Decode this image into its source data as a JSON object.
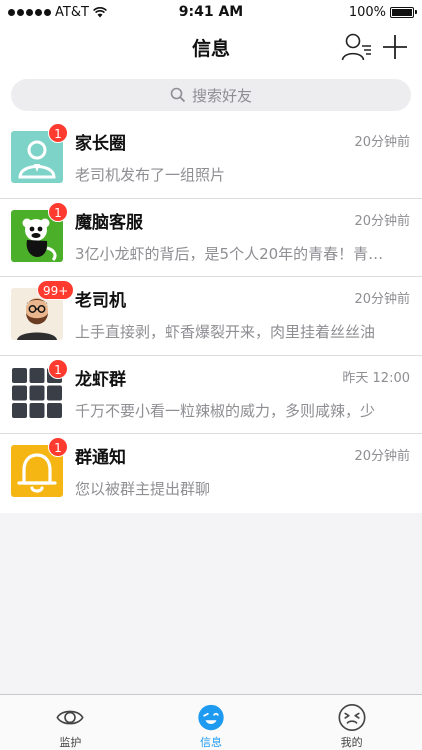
{
  "status_bar": {
    "carrier": "AT&T",
    "time": "9:41 AM",
    "battery": "100%"
  },
  "header": {
    "title": "信息"
  },
  "search": {
    "placeholder": "搜索好友"
  },
  "chats": [
    {
      "name": "家长圈",
      "time": "20分钟前",
      "preview": "老司机发布了一组照片",
      "badge": "1",
      "avatar": "parents-circle-avatar"
    },
    {
      "name": "魔脑客服",
      "time": "20分钟前",
      "preview": "3亿小龙虾的背后，是5个人20年的青春！青…",
      "badge": "1",
      "avatar": "monkey-avatar"
    },
    {
      "name": "老司机",
      "time": "20分钟前",
      "preview": "上手直接剥，虾香爆裂开来，肉里挂着丝丝油",
      "badge": "99+",
      "avatar": "bearded-man-avatar"
    },
    {
      "name": "龙虾群",
      "time": "昨天 12:00",
      "preview": "千万不要小看一粒辣椒的威力，多则咸辣，少",
      "badge": "1",
      "avatar": "group-grid-avatar"
    },
    {
      "name": "群通知",
      "time": "20分钟前",
      "preview": "您以被群主提出群聊",
      "badge": "1",
      "avatar": "bell-avatar"
    }
  ],
  "tabs": [
    {
      "label": "监护",
      "icon": "eye-icon",
      "active": false
    },
    {
      "label": "信息",
      "icon": "wink-face-icon",
      "active": true
    },
    {
      "label": "我的",
      "icon": "squint-face-icon",
      "active": false
    }
  ],
  "colors": {
    "accent": "#1e9bf0",
    "badge": "#ff3b30",
    "avatar_teal": "#7dd3c8",
    "avatar_green": "#4caf2a",
    "avatar_yellow": "#f5b614",
    "avatar_dark": "#3a3e47"
  }
}
